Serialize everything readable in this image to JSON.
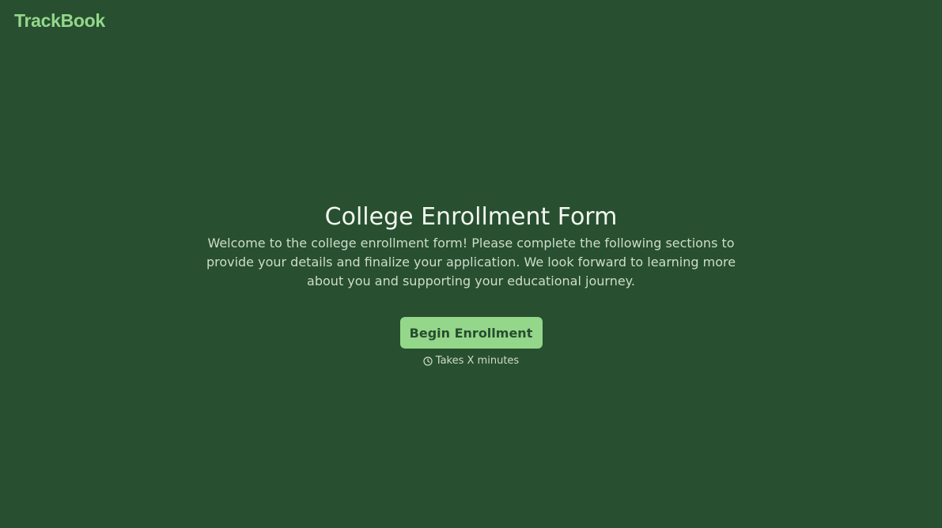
{
  "brand": {
    "logo_text": "TrackBook"
  },
  "main": {
    "title": "College Enrollment Form",
    "intro": "Welcome to the college enrollment form! Please complete the following sections to provide your details and finalize your application. We look forward to learning more about you and supporting your educational journey.",
    "cta_label": "Begin Enrollment",
    "duration_icon": "clock-icon",
    "duration_text": "Takes X minutes"
  },
  "colors": {
    "background": "#274f30",
    "accent": "#94d78a",
    "button_text": "#264d2f",
    "title_text": "#f2f7ef",
    "body_text": "#cfdcc9"
  }
}
